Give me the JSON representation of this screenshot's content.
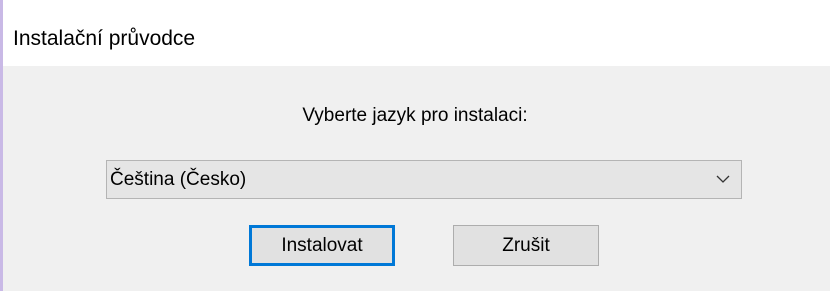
{
  "window": {
    "title": "Instalační průvodce"
  },
  "main": {
    "prompt": "Vyberte jazyk pro instalaci:",
    "language_select": {
      "selected": "Čeština (Česko)",
      "icon": "chevron-down-icon"
    },
    "buttons": {
      "install_label": "Instalovat",
      "cancel_label": "Zrušit"
    }
  },
  "colors": {
    "background": "#f0f0f0",
    "titlebar": "#ffffff",
    "focus_border": "#0078d7",
    "left_edge": "#c9b9e6"
  }
}
